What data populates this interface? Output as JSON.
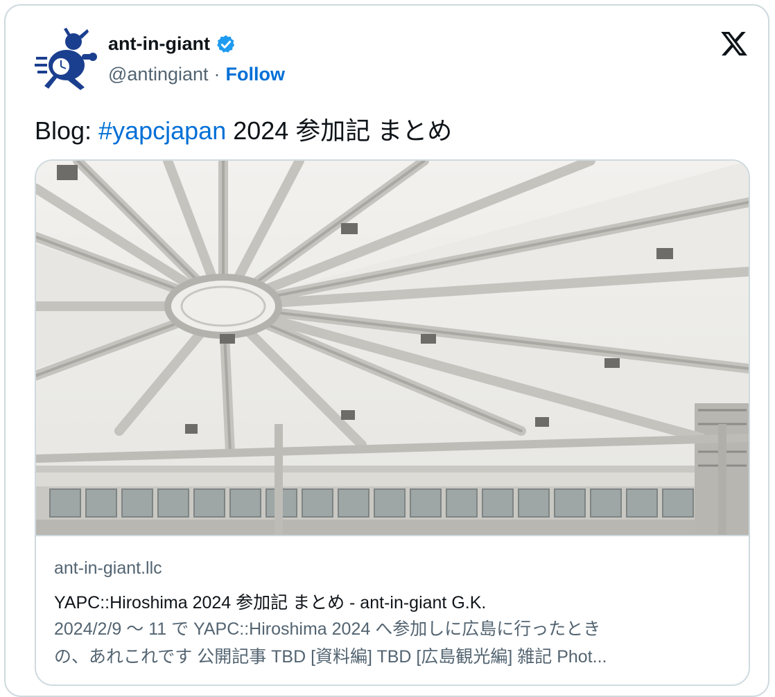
{
  "author": {
    "name": "ant-in-giant",
    "handle": "@antingiant",
    "separator": "·",
    "follow_label": "Follow"
  },
  "icons": {
    "avatar": "ant-logo-avatar",
    "verified": "verified-badge-icon",
    "brand": "x-logo-icon"
  },
  "tweet": {
    "prefix": "Blog: ",
    "hashtag": "#yapcjapan",
    "suffix": " 2024 参加記 まとめ"
  },
  "link_card": {
    "image": "white-membrane-canopy-roof-photo",
    "domain": "ant-in-giant.llc",
    "title": "YAPC::Hiroshima 2024 参加記 まとめ - ant-in-giant G.K.",
    "description_line1": "2024/2/9 〜 11 で YAPC::Hiroshima 2024 へ参加しに広島に行ったとき",
    "description_line2": "の、あれこれです 公開記事 TBD [資料編] TBD [広島観光編] 雑記 Phot..."
  },
  "colors": {
    "link_blue": "#006fd6",
    "verified_blue": "#1d9bf0",
    "secondary_text": "#536471",
    "avatar_navy": "#1b3f8f",
    "border": "#cfd9de"
  }
}
